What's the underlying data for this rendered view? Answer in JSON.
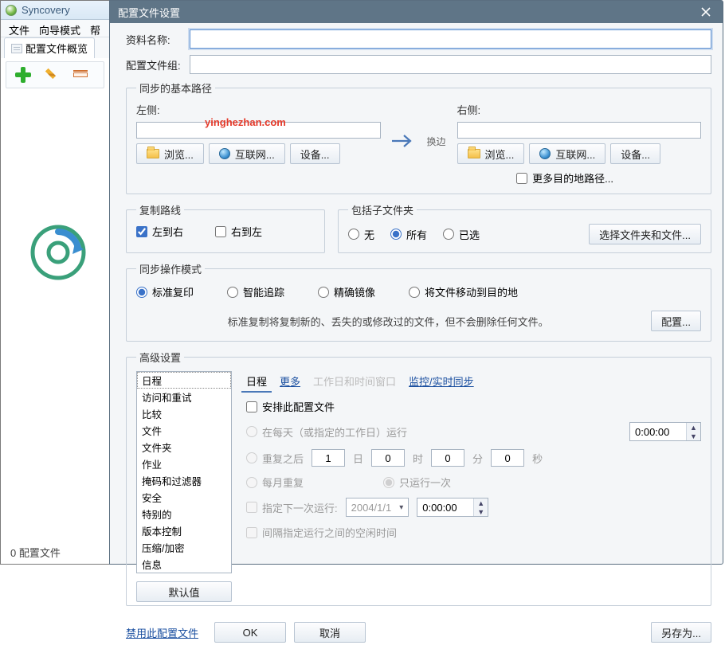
{
  "app": {
    "title": "Syncovery"
  },
  "menu": [
    "文件",
    "向导模式",
    "帮"
  ],
  "mainTab": "配置文件概览",
  "footerCount": "0 配置文件",
  "watermark": "yinghezhan.com",
  "dlg": {
    "title": "配置文件设置",
    "labels": {
      "profileName": "资料名称:",
      "profileGroup": "配置文件组:"
    },
    "fields": {
      "profileName": "",
      "profileGroup": ""
    },
    "paths": {
      "legend": "同步的基本路径",
      "leftLabel": "左侧:",
      "rightLabel": "右侧:",
      "leftVal": "",
      "rightVal": "",
      "browse": "浏览...",
      "internet": "互联网...",
      "device": "设备...",
      "swap": "换边",
      "moreDest": "更多目的地路径..."
    },
    "copy": {
      "legend": "复制路线",
      "lr": "左到右",
      "rl": "右到左"
    },
    "sub": {
      "legend": "包括子文件夹",
      "none": "无",
      "all": "所有",
      "sel": "已选",
      "btn": "选择文件夹和文件..."
    },
    "mode": {
      "legend": "同步操作模式",
      "std": "标准复印",
      "smart": "智能追踪",
      "mirror": "精确镜像",
      "move": "将文件移动到目的地",
      "desc": "标准复制将复制新的、丢失的或修改过的文件，但不会删除任何文件。",
      "cfg": "配置..."
    },
    "adv": {
      "legend": "高级设置",
      "items": [
        "日程",
        "访问和重试",
        "比较",
        "文件",
        "文件夹",
        "作业",
        "掩码和过滤器",
        "安全",
        "特别的",
        "版本控制",
        "压缩/加密",
        "信息"
      ],
      "defaults": "默认值",
      "tabs": {
        "cal": "日程",
        "more": "更多",
        "work": "工作日和时间窗口",
        "mon": "监控/实时同步"
      },
      "sched": {
        "arrange": "安排此配置文件",
        "daily": "在每天（或指定的工作日）运行",
        "time1": "0:00:00",
        "repeat": "重复之后",
        "d": "日",
        "h": "时",
        "m": "分",
        "s": "秒",
        "dval": "1",
        "hval": "0",
        "mval": "0",
        "sval": "0",
        "monthly": "每月重复",
        "once": "只运行一次",
        "nextRun": "指定下一次运行:",
        "date": "2004/1/1",
        "time2": "0:00:00",
        "idle": "间隔指定运行之间的空闲时间"
      }
    },
    "footer": {
      "disable": "禁用此配置文件",
      "ok": "OK",
      "cancel": "取消",
      "saveAs": "另存为..."
    }
  }
}
